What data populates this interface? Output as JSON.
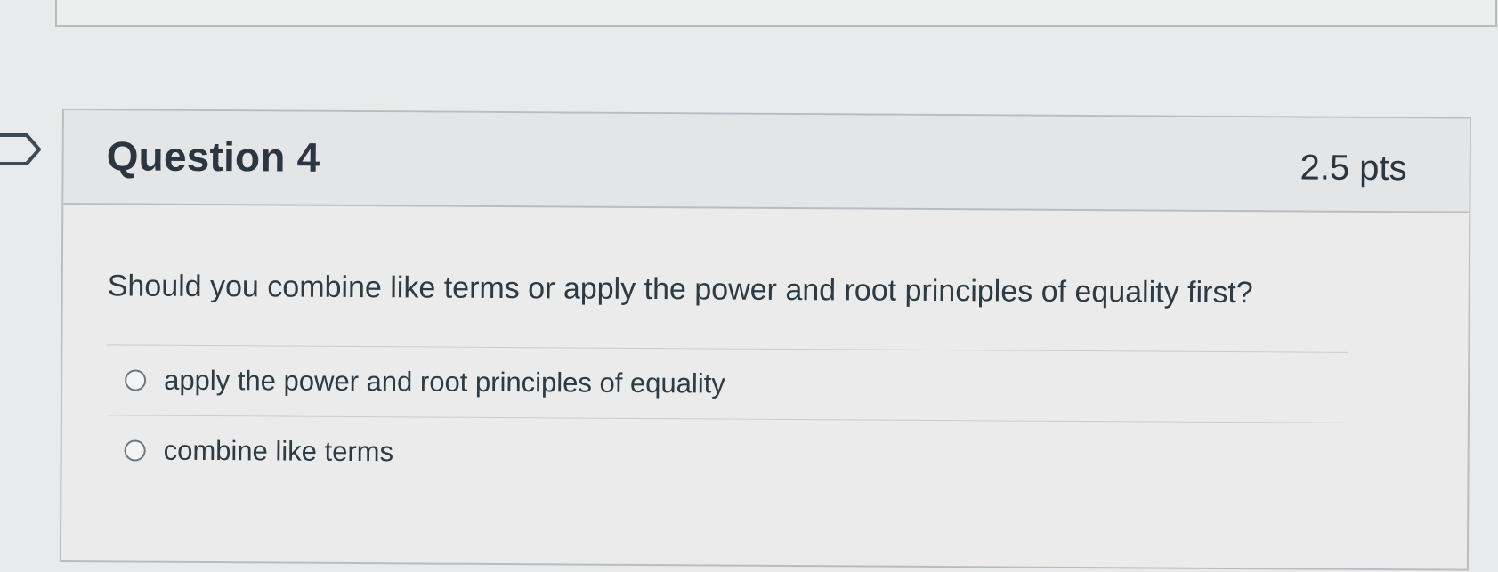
{
  "question": {
    "title": "Question 4",
    "points": "2.5 pts",
    "text": "Should you combine like terms or apply the power and root principles of equality first?",
    "answers": [
      {
        "label": "apply the power and root principles of equality",
        "selected": false
      },
      {
        "label": "combine like terms",
        "selected": false
      }
    ]
  },
  "icons": {
    "bookmark": "bookmark-flag-icon",
    "radio": "radio-button-icon"
  },
  "colors": {
    "background": "#e9eaec",
    "text": "#2d3b45",
    "border": "#b9bdc1"
  }
}
